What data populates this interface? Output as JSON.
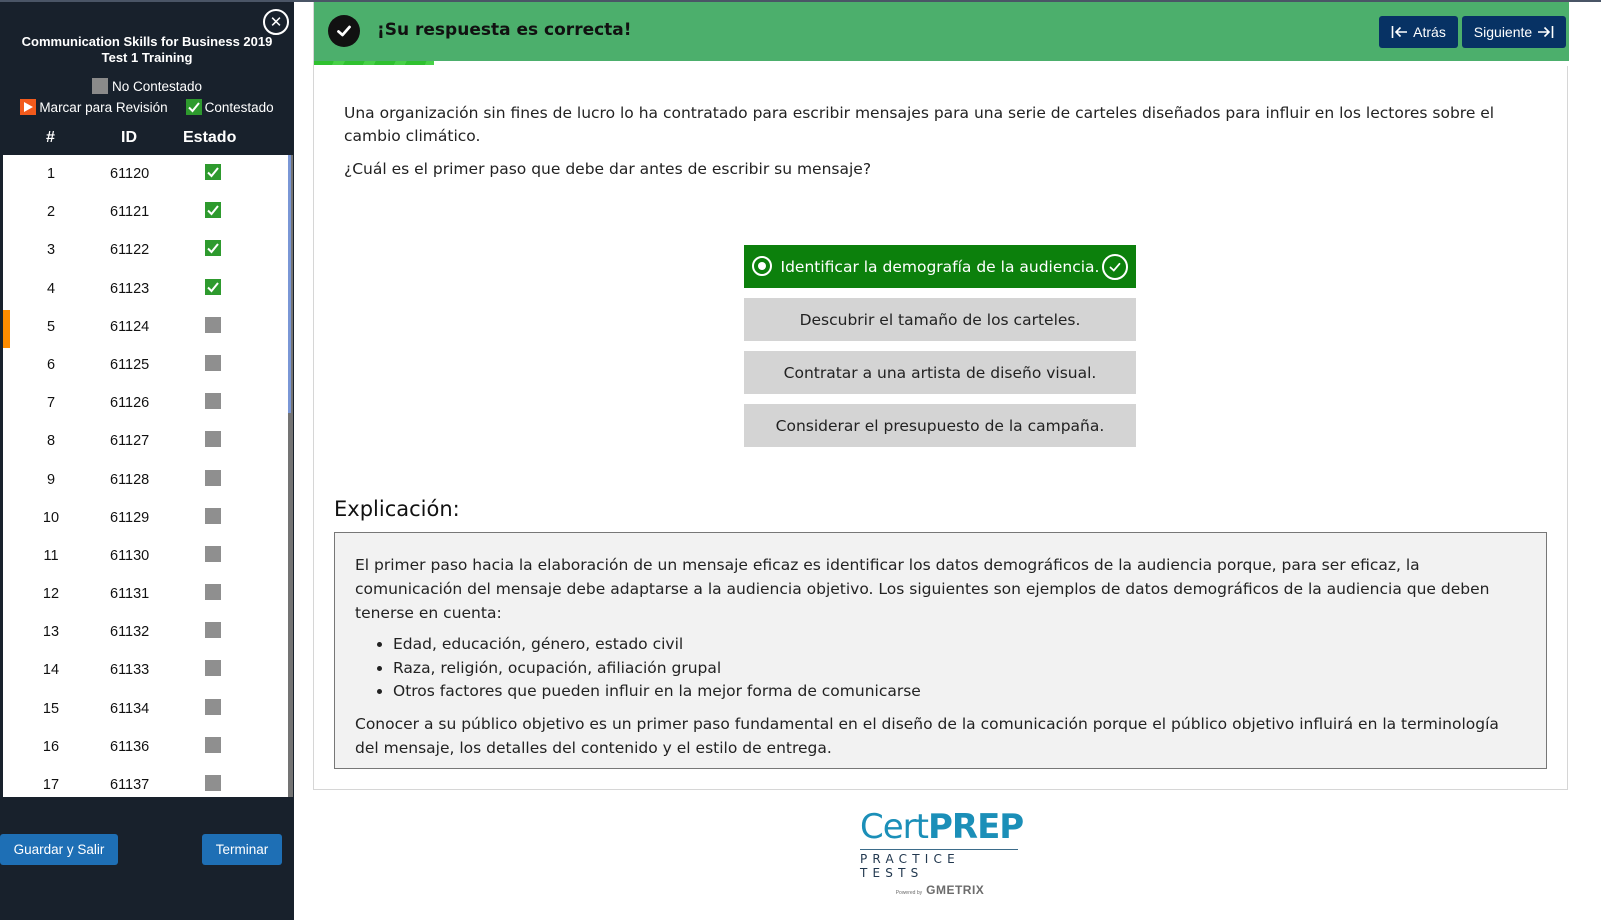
{
  "sidebar": {
    "title_line1": "Communication Skills for Business 2019",
    "title_line2": "Test 1 Training",
    "close_icon": "close-circle-icon",
    "legend": {
      "not_answered": "No Contestado",
      "flag_review": "Marcar para Revisión",
      "answered": "Contestado"
    },
    "columns": {
      "num": "#",
      "id": "ID",
      "status": "Estado"
    },
    "current_question": 5,
    "questions": [
      {
        "num": "1",
        "id": "61120",
        "status": "answered"
      },
      {
        "num": "2",
        "id": "61121",
        "status": "answered"
      },
      {
        "num": "3",
        "id": "61122",
        "status": "answered"
      },
      {
        "num": "4",
        "id": "61123",
        "status": "answered"
      },
      {
        "num": "5",
        "id": "61124",
        "status": "unanswered"
      },
      {
        "num": "6",
        "id": "61125",
        "status": "unanswered"
      },
      {
        "num": "7",
        "id": "61126",
        "status": "unanswered"
      },
      {
        "num": "8",
        "id": "61127",
        "status": "unanswered"
      },
      {
        "num": "9",
        "id": "61128",
        "status": "unanswered"
      },
      {
        "num": "10",
        "id": "61129",
        "status": "unanswered"
      },
      {
        "num": "11",
        "id": "61130",
        "status": "unanswered"
      },
      {
        "num": "12",
        "id": "61131",
        "status": "unanswered"
      },
      {
        "num": "13",
        "id": "61132",
        "status": "unanswered"
      },
      {
        "num": "14",
        "id": "61133",
        "status": "unanswered"
      },
      {
        "num": "15",
        "id": "61134",
        "status": "unanswered"
      },
      {
        "num": "16",
        "id": "61136",
        "status": "unanswered"
      },
      {
        "num": "17",
        "id": "61137",
        "status": "unanswered"
      }
    ],
    "save_exit_label": "Guardar y Salir",
    "finish_label": "Terminar"
  },
  "banner": {
    "message": "¡Su respuesta es correcta!",
    "icon": "check-circle-icon",
    "back_label": "Atrás",
    "next_label": "Siguiente",
    "progress_fraction": 0.096
  },
  "question": {
    "scenario": "Una organización sin fines de lucro lo ha contratado para escribir mensajes para una serie de carteles diseñados para influir en los lectores sobre el cambio climático.",
    "prompt": "¿Cuál es el primer paso que debe dar antes de escribir su mensaje?",
    "answers": [
      {
        "label": "Identificar la demografía de la audiencia.",
        "selected": true,
        "correct": true
      },
      {
        "label": "Descubrir el tamaño de los carteles.",
        "selected": false,
        "correct": false
      },
      {
        "label": "Contratar a una artista de diseño visual.",
        "selected": false,
        "correct": false
      },
      {
        "label": "Considerar el presupuesto de la campaña.",
        "selected": false,
        "correct": false
      }
    ]
  },
  "explanation": {
    "title": "Explicación:",
    "paragraph1": "El primer paso hacia la elaboración de un mensaje eficaz es identificar los datos demográficos de la audiencia porque, para ser eficaz, la comunicación del mensaje debe adaptarse a la audiencia objetivo. Los siguientes son ejemplos de datos demográficos de la audiencia que deben tenerse en cuenta:",
    "bullets": [
      "Edad, educación, género, estado civil",
      "Raza, religión, ocupación, afiliación grupal",
      "Otros factores que pueden influir en la mejor forma de comunicarse"
    ],
    "paragraph2": "Conocer a su público objetivo es un primer paso fundamental en el diseño de la comunicación porque el público objetivo influirá en la terminología del mensaje, los detalles del contenido y el estilo de entrega."
  },
  "logo": {
    "cert": "Cert",
    "prep": "PREP",
    "tagline": "PRACTICE TESTS",
    "powered_by": "Powered by",
    "brand": "GMETRIX"
  },
  "colors": {
    "sidebar_bg": "#18212c",
    "banner_green": "#4caf6c",
    "correct_green": "#0c800c",
    "nav_button": "#073264",
    "sidebar_button": "#1e6fb5",
    "current_marker": "#ff8c00",
    "answered": "#2e9a2e",
    "unanswered": "#8f8f8f"
  }
}
